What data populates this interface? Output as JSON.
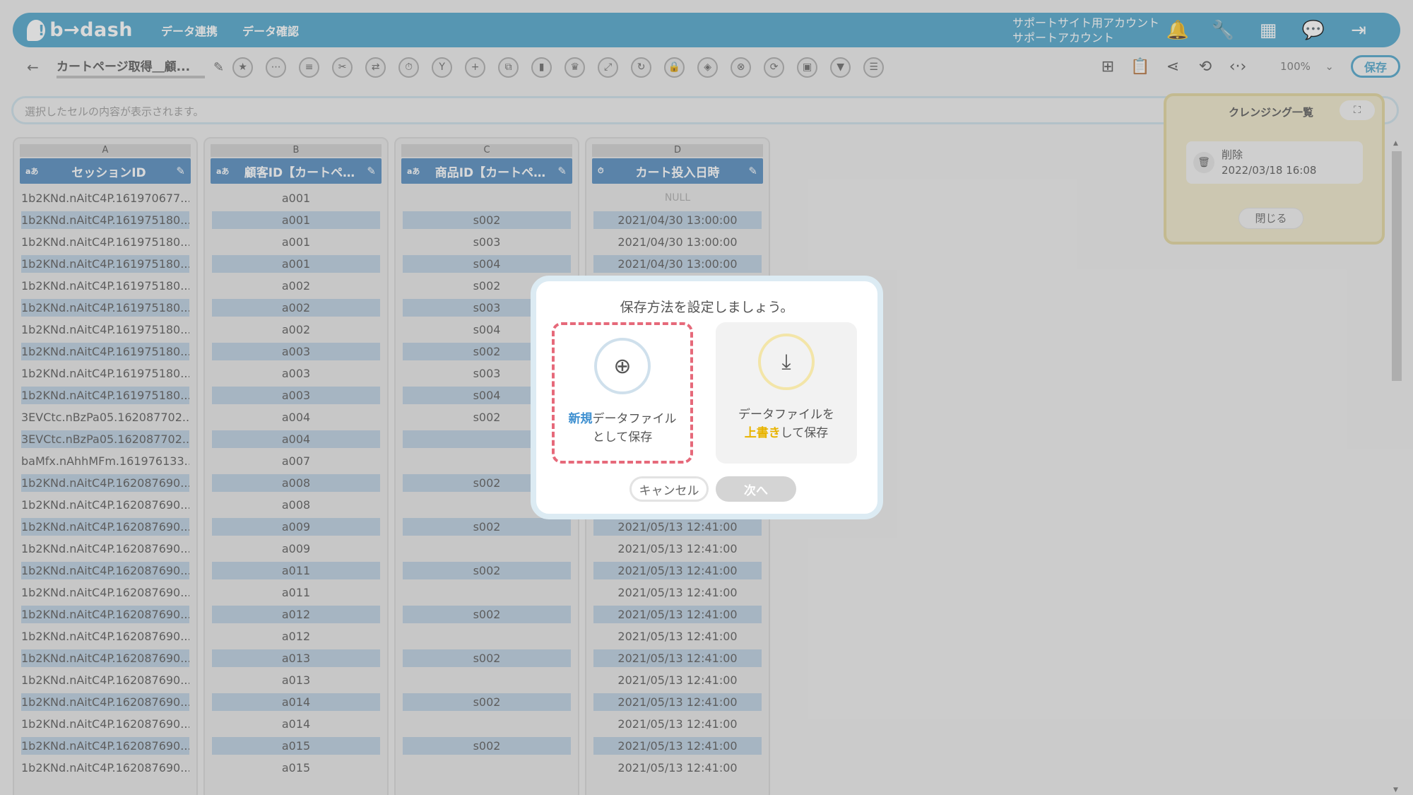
{
  "app": {
    "logo_text": "b→dash",
    "nav": [
      "データ連携",
      "データ確認"
    ],
    "account_line1": "サポートサイト用アカウント",
    "account_line2": "サポートアカウント"
  },
  "toolbar": {
    "doc_title": "カートページ取得＿顧...",
    "zoom": "100%",
    "save_label": "保存"
  },
  "cellbar": {
    "placeholder": "選択したセルの内容が表示されます。"
  },
  "grid": {
    "columns": [
      {
        "letter": "A",
        "type": "aあ",
        "header": "セッションID"
      },
      {
        "letter": "B",
        "type": "aあ",
        "header": "顧客ID【カートペ…"
      },
      {
        "letter": "C",
        "type": "aあ",
        "header": "商品ID【カートペ…"
      },
      {
        "letter": "D",
        "type": "⏱",
        "header": "カート投入日時"
      }
    ],
    "rows": [
      [
        "1b2KNd.nAitC4P.161970677...",
        "a001",
        "",
        "NULL"
      ],
      [
        "1b2KNd.nAitC4P.161975180...",
        "a001",
        "s002",
        "2021/04/30 13:00:00"
      ],
      [
        "1b2KNd.nAitC4P.161975180...",
        "a001",
        "s003",
        "2021/04/30 13:00:00"
      ],
      [
        "1b2KNd.nAitC4P.161975180...",
        "a001",
        "s004",
        "2021/04/30 13:00:00"
      ],
      [
        "1b2KNd.nAitC4P.161975180...",
        "a002",
        "s002",
        ""
      ],
      [
        "1b2KNd.nAitC4P.161975180...",
        "a002",
        "s003",
        ""
      ],
      [
        "1b2KNd.nAitC4P.161975180...",
        "a002",
        "s004",
        ""
      ],
      [
        "1b2KNd.nAitC4P.161975180...",
        "a003",
        "s002",
        ""
      ],
      [
        "1b2KNd.nAitC4P.161975180...",
        "a003",
        "s003",
        ""
      ],
      [
        "1b2KNd.nAitC4P.161975180...",
        "a003",
        "s004",
        ""
      ],
      [
        "3EVCtc.nBzPa05.162087702...",
        "a004",
        "s002",
        ""
      ],
      [
        "3EVCtc.nBzPa05.162087702...",
        "a004",
        "",
        ""
      ],
      [
        "baMfx.nAhhMFm.161976133...",
        "a007",
        "",
        ""
      ],
      [
        "1b2KNd.nAitC4P.162087690...",
        "a008",
        "s002",
        ""
      ],
      [
        "1b2KNd.nAitC4P.162087690...",
        "a008",
        "",
        ""
      ],
      [
        "1b2KNd.nAitC4P.162087690...",
        "a009",
        "s002",
        "2021/05/13 12:41:00"
      ],
      [
        "1b2KNd.nAitC4P.162087690...",
        "a009",
        "",
        "2021/05/13 12:41:00"
      ],
      [
        "1b2KNd.nAitC4P.162087690...",
        "a011",
        "s002",
        "2021/05/13 12:41:00"
      ],
      [
        "1b2KNd.nAitC4P.162087690...",
        "a011",
        "",
        "2021/05/13 12:41:00"
      ],
      [
        "1b2KNd.nAitC4P.162087690...",
        "a012",
        "s002",
        "2021/05/13 12:41:00"
      ],
      [
        "1b2KNd.nAitC4P.162087690...",
        "a012",
        "",
        "2021/05/13 12:41:00"
      ],
      [
        "1b2KNd.nAitC4P.162087690...",
        "a013",
        "s002",
        "2021/05/13 12:41:00"
      ],
      [
        "1b2KNd.nAitC4P.162087690...",
        "a013",
        "",
        "2021/05/13 12:41:00"
      ],
      [
        "1b2KNd.nAitC4P.162087690...",
        "a014",
        "s002",
        "2021/05/13 12:41:00"
      ],
      [
        "1b2KNd.nAitC4P.162087690...",
        "a014",
        "",
        "2021/05/13 12:41:00"
      ],
      [
        "1b2KNd.nAitC4P.162087690...",
        "a015",
        "s002",
        "2021/05/13 12:41:00"
      ],
      [
        "1b2KNd.nAitC4P.162087690...",
        "a015",
        "",
        "2021/05/13 12:41:00"
      ]
    ]
  },
  "cleansing_panel": {
    "title": "クレンジング一覧",
    "item_name": "削除",
    "item_date": "2022/03/18 16:08",
    "close_label": "閉じる"
  },
  "modal": {
    "title": "保存方法を設定しましょう。",
    "option_new_highlight": "新規",
    "option_new_rest": "データファイル",
    "option_new_line2": "として保存",
    "option_overwrite_line1": "データファイルを",
    "option_overwrite_highlight": "上書き",
    "option_overwrite_rest": "して保存",
    "cancel_label": "キャンセル",
    "next_label": "次へ"
  },
  "colors": {
    "brand": "#4aa3c9",
    "header_cell": "#4f88bd",
    "accent_red": "#e6697a",
    "accent_yellow": "#e8b400"
  }
}
